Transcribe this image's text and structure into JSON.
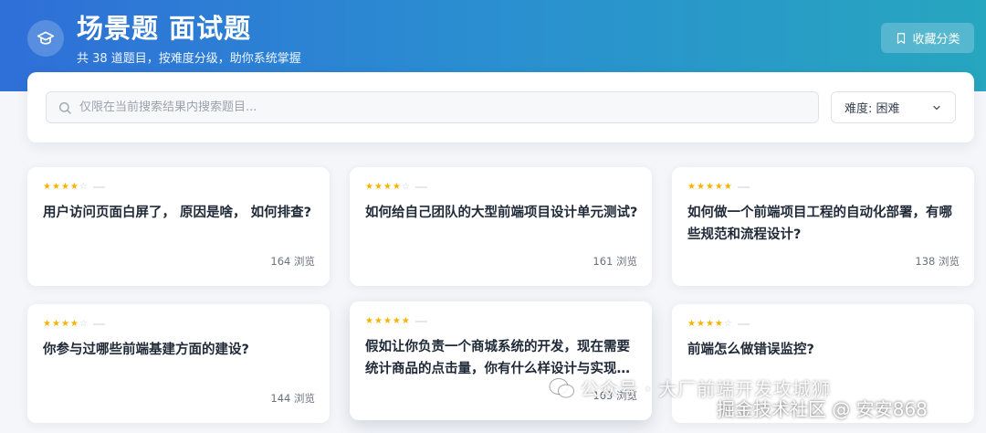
{
  "header": {
    "title": "场景题 面试题",
    "subtitle": "共 38 道题目，按难度分级，助你系统掌握",
    "favorite_label": "收藏分类",
    "icon": "graduation-cap-icon"
  },
  "search": {
    "placeholder": "仅限在当前搜索结果内搜索题目...",
    "value": ""
  },
  "filter": {
    "difficulty_label": "难度: 困难"
  },
  "cards": [
    {
      "title": "用户访问页面白屏了， 原因是啥， 如何排查?",
      "views": "164 浏览",
      "rating": 4
    },
    {
      "title": "如何给自己团队的大型前端项目设计单元测试?",
      "views": "161 浏览",
      "rating": 4
    },
    {
      "title": "如何做一个前端项目工程的自动化部署，有哪些规范和流程设计?",
      "views": "138 浏览",
      "rating": 5
    },
    {
      "title": "你参与过哪些前端基建方面的建设?",
      "views": "144 浏览",
      "rating": 4
    },
    {
      "title": "假如让你负责一个商城系统的开发，现在需要统计商品的点击量，你有什么样设计与实现的思路?",
      "views": "163 浏览",
      "rating": 5
    },
    {
      "title": "前端怎么做错误监控?",
      "views": "",
      "rating": 4
    }
  ],
  "watermark": {
    "line1": "公众号 · 大厂前端开发攻城狮",
    "line2": "掘金技术社区 @ 安安868"
  },
  "colors": {
    "accent": "#2f6fd8",
    "star": "#f5b301"
  }
}
